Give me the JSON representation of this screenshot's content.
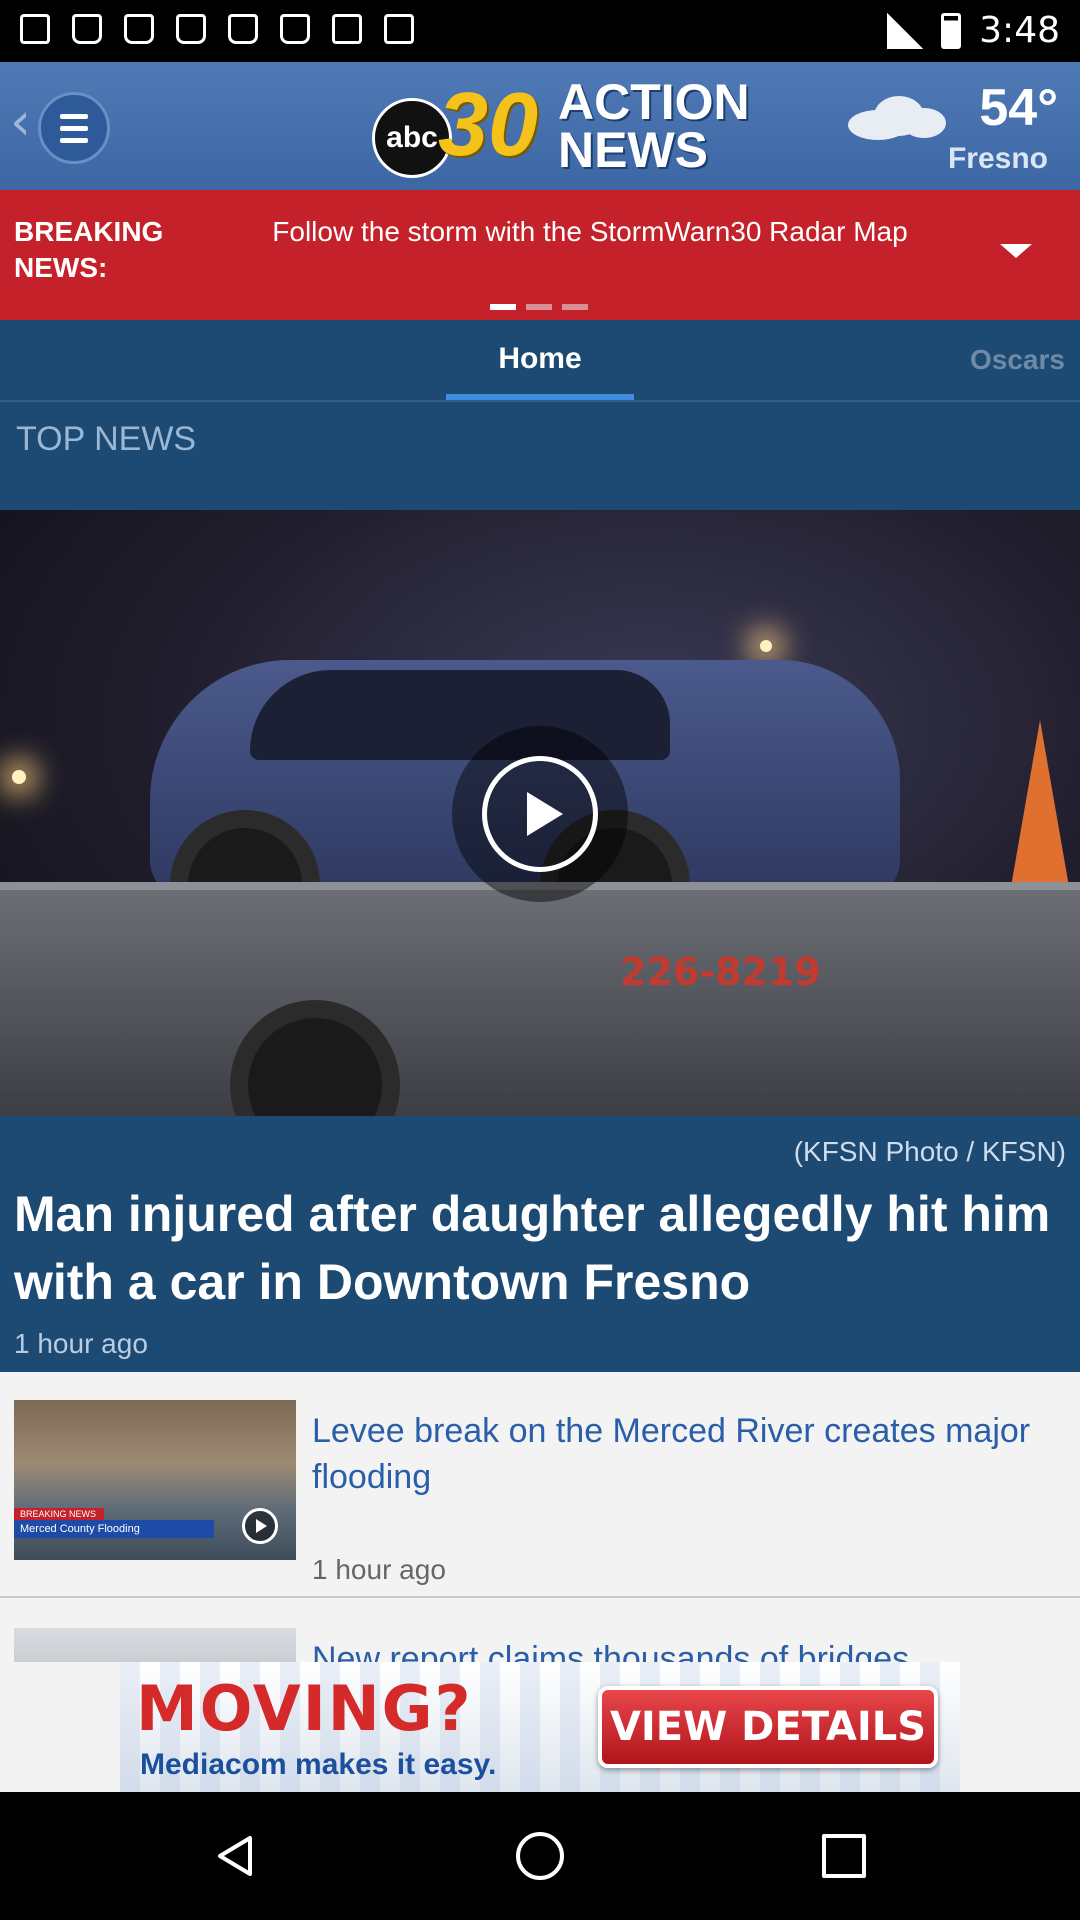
{
  "status_bar": {
    "time": "3:48"
  },
  "header": {
    "logo": {
      "network": "abc",
      "channel_number": "30",
      "word_line1": "ACTION",
      "word_line2": "NEWS"
    },
    "weather": {
      "icon": "cloud-icon",
      "temperature": "54°",
      "city": "Fresno"
    }
  },
  "breaking": {
    "label": "BREAKING NEWS:",
    "text": "Follow the storm with the StormWarn30 Radar Map",
    "background": "#c4212a"
  },
  "tabs": [
    {
      "label": "Home",
      "selected": true
    },
    {
      "label": "Oscars",
      "selected": false
    }
  ],
  "section_title": "TOP NEWS",
  "hero": {
    "plate_text": "226-8219",
    "credit": "(KFSN Photo / KFSN)",
    "headline": "Man injured after daughter allegedly hit him with a car in Downtown Fresno",
    "time": "1 hour ago"
  },
  "list": [
    {
      "title": "Levee break on the Merced River creates major flooding",
      "time": "1 hour ago",
      "thumb_banner": "Merced County Flooding",
      "thumb_tag": "BREAKING NEWS"
    },
    {
      "title": "New report claims thousands of bridges"
    }
  ],
  "ad": {
    "headline": "MOVING?",
    "subline": "Mediacom makes it easy.",
    "button": "VIEW DETAILS"
  }
}
